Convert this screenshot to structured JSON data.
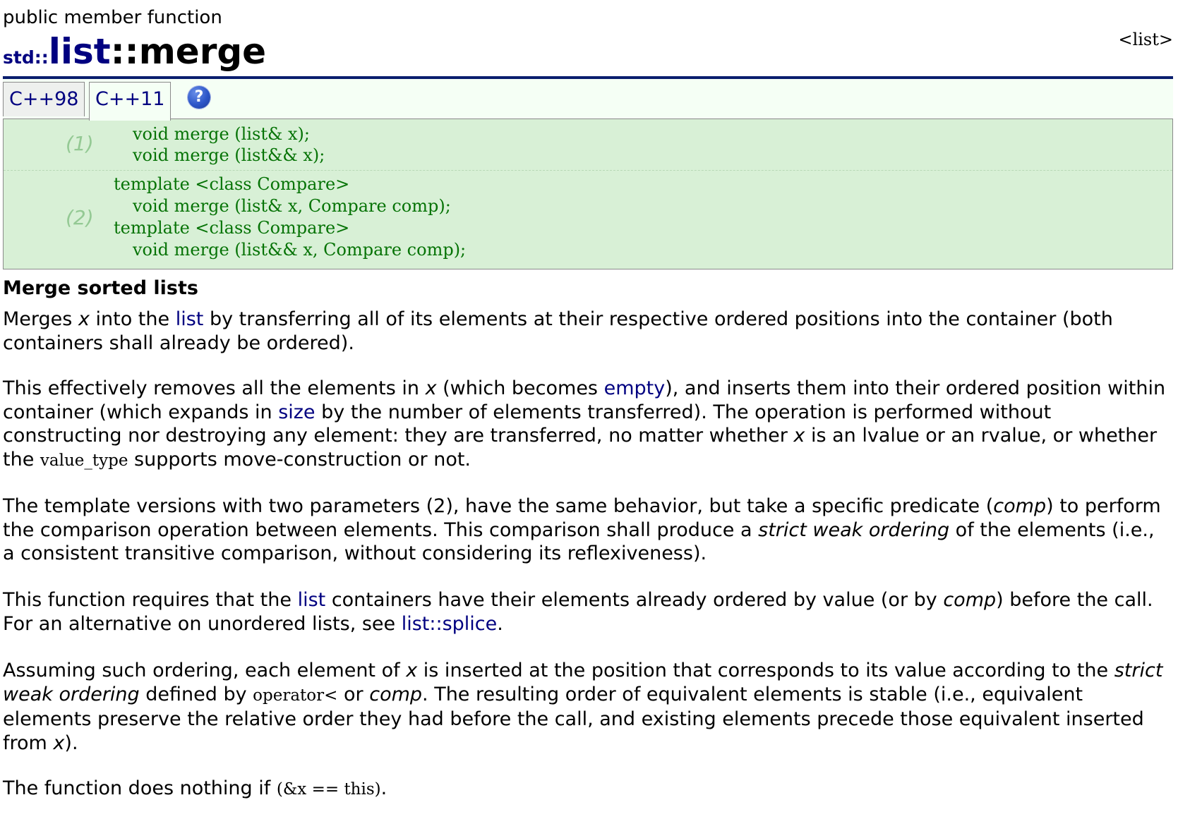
{
  "header": {
    "kind": "public member function",
    "namespace": "std::",
    "class_name": "list",
    "scope_sep": "::",
    "function_name": "merge",
    "library": "<list>"
  },
  "tabs": [
    {
      "label": "C++98",
      "active": false
    },
    {
      "label": "C++11",
      "active": true
    }
  ],
  "help_icon": "?",
  "prototypes": {
    "group1": {
      "number": "(1)",
      "lines": [
        "void merge (list& x);",
        "void merge (list&& x);"
      ]
    },
    "group2": {
      "number": "(2)",
      "lines": [
        "template <class Compare>",
        "void merge (list& x, Compare comp);",
        "template <class Compare>",
        "void merge (list&& x, Compare comp);"
      ]
    }
  },
  "description": {
    "title": "Merge sorted lists",
    "p1": {
      "t1": "Merges ",
      "x": "x",
      "t2": " into the ",
      "link_list": "list",
      "t3": " by transferring all of its elements at their respective ordered positions into the container (both containers shall already be ordered)."
    },
    "p2": {
      "t1": "This effectively removes all the elements in ",
      "x1": "x",
      "t2": " (which becomes ",
      "link_empty": "empty",
      "t3": "), and inserts them into their ordered position within container (which expands in ",
      "link_size": "size",
      "t4": " by the number of elements transferred). The operation is performed without constructing nor destroying any element: they are transferred, no matter whether ",
      "x2": "x",
      "t5": " is an lvalue or an rvalue, or whether the ",
      "code": "value_type",
      "t6": " supports move-construction or not."
    },
    "p3": {
      "t1": "The template versions with two parameters (2), have the same behavior, but take a specific predicate (",
      "comp": "comp",
      "t2": ") to perform the comparison operation between elements. This comparison shall produce a ",
      "swo": "strict weak ordering",
      "t3": " of the elements (i.e., a consistent transitive comparison, without considering its reflexiveness)."
    },
    "p4": {
      "t1": "This function requires that the ",
      "link_list": "list",
      "t2": " containers have their elements already ordered by value (or by ",
      "comp": "comp",
      "t3": ") before the call. For an alternative on unordered lists, see ",
      "link_splice": "list::splice",
      "t4": "."
    },
    "p5": {
      "t1": "Assuming such ordering, each element of ",
      "x1": "x",
      "t2": " is inserted at the position that corresponds to its value according to the ",
      "swo": "strict weak ordering",
      "t3": " defined by ",
      "code": "operator<",
      "t4": " or ",
      "comp": "comp",
      "t5": ". The resulting order of equivalent elements is stable (i.e., equivalent elements preserve the relative order they had before the call, and existing elements precede those equivalent inserted from ",
      "x2": "x",
      "t6": ")."
    },
    "p6": {
      "t1": "The function does nothing if ",
      "code": "(&x == this)",
      "t2": "."
    }
  }
}
